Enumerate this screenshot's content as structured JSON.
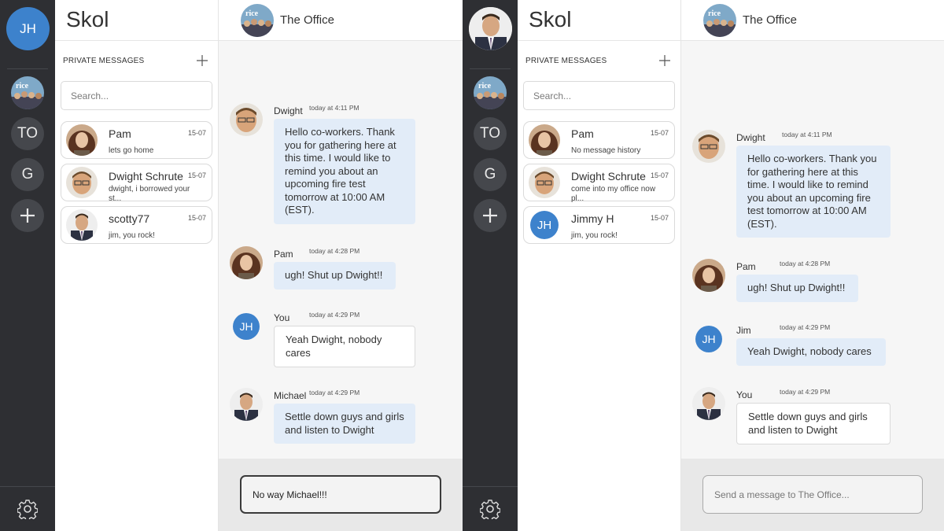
{
  "app1": {
    "user_initials": "JH",
    "servers": [
      {
        "kind": "group-photo",
        "label": "rice",
        "icon": "office-group-avatar"
      },
      {
        "kind": "initials",
        "label": "TO"
      },
      {
        "kind": "initials",
        "label": "G"
      }
    ],
    "add_server_icon": "plus-icon",
    "settings_icon": "gear-icon",
    "brand": "Skol",
    "pm_title": "PRIVATE MESSAGES",
    "search_placeholder": "Search...",
    "dms": [
      {
        "name": "Pam",
        "date": "15-07",
        "preview": "lets go home",
        "avatar": "pam"
      },
      {
        "name": "Dwight Schrute",
        "date": "15-07",
        "preview": "dwight, i borrowed your st...",
        "avatar": "dwight"
      },
      {
        "name": "scotty77",
        "date": "15-07",
        "preview": "jim, you rock!",
        "avatar": "michael"
      }
    ],
    "chat_title": "The Office",
    "messages": [
      {
        "sender": "Dwight",
        "time": "today at 4:11 PM",
        "text": "Hello co-workers. Thank you for gathering here at this time. I would like to remind you about an upcoming fire test tomorrow at 10:00 AM (EST).",
        "avatar": "dwight"
      },
      {
        "sender": "Pam",
        "time": "today at 4:28 PM",
        "text": "ugh! Shut up Dwight!!",
        "avatar": "pam"
      },
      {
        "sender": "You",
        "time": "today at 4:29 PM",
        "text": "Yeah Dwight, nobody cares",
        "avatar": "JH"
      },
      {
        "sender": "Michael",
        "time": "today at 4:29 PM",
        "text": "Settle down guys and girls and listen to Dwight",
        "avatar": "michael"
      }
    ],
    "composer_value": "No way Michael!!!"
  },
  "app2": {
    "user_avatar": "michael",
    "servers": [
      {
        "kind": "group-photo",
        "label": "rice",
        "icon": "office-group-avatar"
      },
      {
        "kind": "initials",
        "label": "TO"
      },
      {
        "kind": "initials",
        "label": "G"
      }
    ],
    "brand": "Skol",
    "pm_title": "PRIVATE MESSAGES",
    "search_placeholder": "Search...",
    "dms": [
      {
        "name": "Pam",
        "date": "15-07",
        "preview": "No message history",
        "avatar": "pam"
      },
      {
        "name": "Dwight Schrute",
        "date": "15-07",
        "preview": "come into my office now pl...",
        "avatar": "dwight"
      },
      {
        "name": "Jimmy H",
        "date": "15-07",
        "preview": "jim, you rock!",
        "avatar": "JH"
      }
    ],
    "chat_title": "The Office",
    "messages": [
      {
        "sender": "Dwight",
        "time": "today at 4:11 PM",
        "text": "Hello co-workers. Thank you for gathering here at this time. I would like to remind you about an upcoming fire test tomorrow at 10:00 AM (EST).",
        "avatar": "dwight"
      },
      {
        "sender": "Pam",
        "time": "today at 4:28 PM",
        "text": "ugh! Shut up Dwight!!",
        "avatar": "pam"
      },
      {
        "sender": "Jim",
        "time": "today at 4:29 PM",
        "text": "Yeah Dwight, nobody cares",
        "avatar": "JH"
      },
      {
        "sender": "You",
        "time": "today at 4:29 PM",
        "text": "Settle down guys and girls and listen to Dwight",
        "avatar": "michael"
      }
    ],
    "composer_placeholder": "Send a message to The Office..."
  },
  "colors": {
    "rail": "#2e2f33",
    "accent_blue": "#3d82cc",
    "bubble": "#e2ecf8",
    "chat_bg": "#f6f6f6"
  }
}
